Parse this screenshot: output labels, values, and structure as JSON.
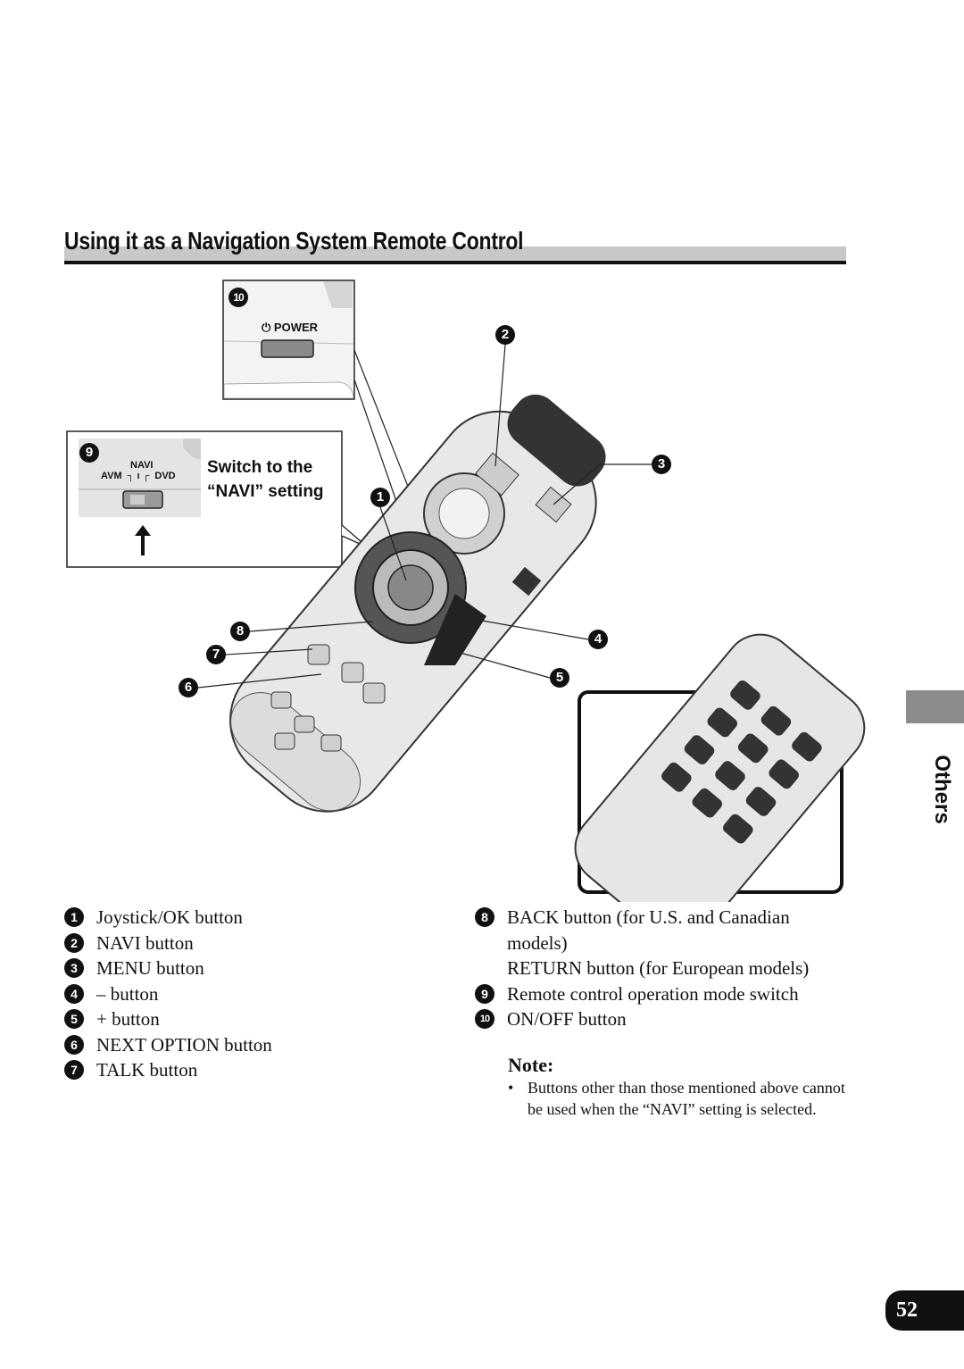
{
  "section": {
    "title": "Using it as a Navigation System Remote Control"
  },
  "figure": {
    "power_label": "POWER",
    "mode_switch": {
      "navi": "NAVI",
      "avm": "AVM",
      "dvd": "DVD"
    },
    "switch_caption_line1": "Switch to the",
    "switch_caption_line2": "“NAVI” setting",
    "callouts": [
      "1",
      "2",
      "3",
      "4",
      "5",
      "6",
      "7",
      "8",
      "9",
      "10"
    ]
  },
  "legend_left": [
    {
      "num": "1",
      "text": "Joystick/OK button"
    },
    {
      "num": "2",
      "text": "NAVI button"
    },
    {
      "num": "3",
      "text": "MENU button"
    },
    {
      "num": "4",
      "text": "– button"
    },
    {
      "num": "5",
      "text": "+ button"
    },
    {
      "num": "6",
      "text": "NEXT OPTION button"
    },
    {
      "num": "7",
      "text": "TALK button"
    }
  ],
  "legend_right": {
    "item8": {
      "num": "8",
      "line1": "BACK button (for U.S. and Canadian",
      "line2": "models)",
      "line3": "RETURN button (for European models)"
    },
    "item9": {
      "num": "9",
      "text": "Remote control operation mode switch"
    },
    "item10": {
      "num": "10",
      "text": "ON/OFF button"
    }
  },
  "note": {
    "title": "Note:",
    "bullet": "•",
    "text": "Buttons other than those mentioned above cannot be used when the “NAVI” setting is selected."
  },
  "side_tab": {
    "label": "Others"
  },
  "page_number": "52"
}
